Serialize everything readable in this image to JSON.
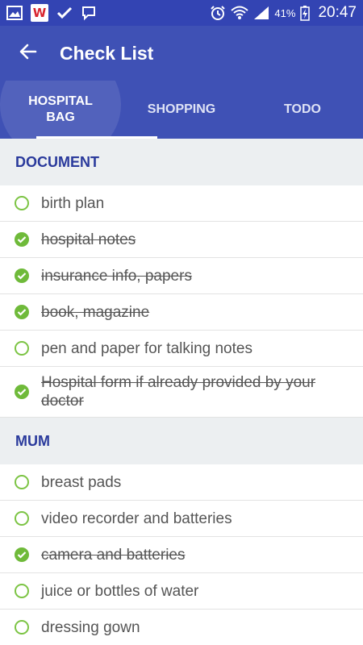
{
  "status_bar": {
    "battery_percent": "41%",
    "time": "20:47",
    "left_icons": [
      "gallery-icon",
      "w-app-icon",
      "check-icon",
      "chat-icon"
    ],
    "right_icons": [
      "alarm-icon",
      "wifi-icon",
      "signal-icon",
      "battery-charging-icon"
    ]
  },
  "app_bar": {
    "title": "Check List",
    "back_icon": "arrow-left-icon"
  },
  "tabs": [
    {
      "label": "HOSPITAL BAG",
      "selected": true
    },
    {
      "label": "SHOPPING",
      "selected": false
    },
    {
      "label": "TODO",
      "selected": false
    }
  ],
  "sections": [
    {
      "title": "DOCUMENT",
      "items": [
        {
          "text": "birth plan",
          "checked": false
        },
        {
          "text": "hospital notes",
          "checked": true
        },
        {
          "text": "insurance info, papers",
          "checked": true
        },
        {
          "text": "book, magazine",
          "checked": true
        },
        {
          "text": "pen and paper for talking notes",
          "checked": false
        },
        {
          "text": "Hospital form if already provided by your doctor",
          "checked": true
        }
      ]
    },
    {
      "title": "MUM",
      "items": [
        {
          "text": "breast pads",
          "checked": false
        },
        {
          "text": "video recorder and batteries",
          "checked": false
        },
        {
          "text": "camera and batteries",
          "checked": true
        },
        {
          "text": "juice or bottles of water",
          "checked": false
        },
        {
          "text": "dressing gown",
          "checked": false
        }
      ]
    }
  ],
  "colors": {
    "primary": "#3f51b5",
    "status_bar": "#3344b3",
    "section_header_bg": "#eceff1",
    "section_header_text": "#2a3a9c",
    "check_green": "#6fba3a"
  }
}
